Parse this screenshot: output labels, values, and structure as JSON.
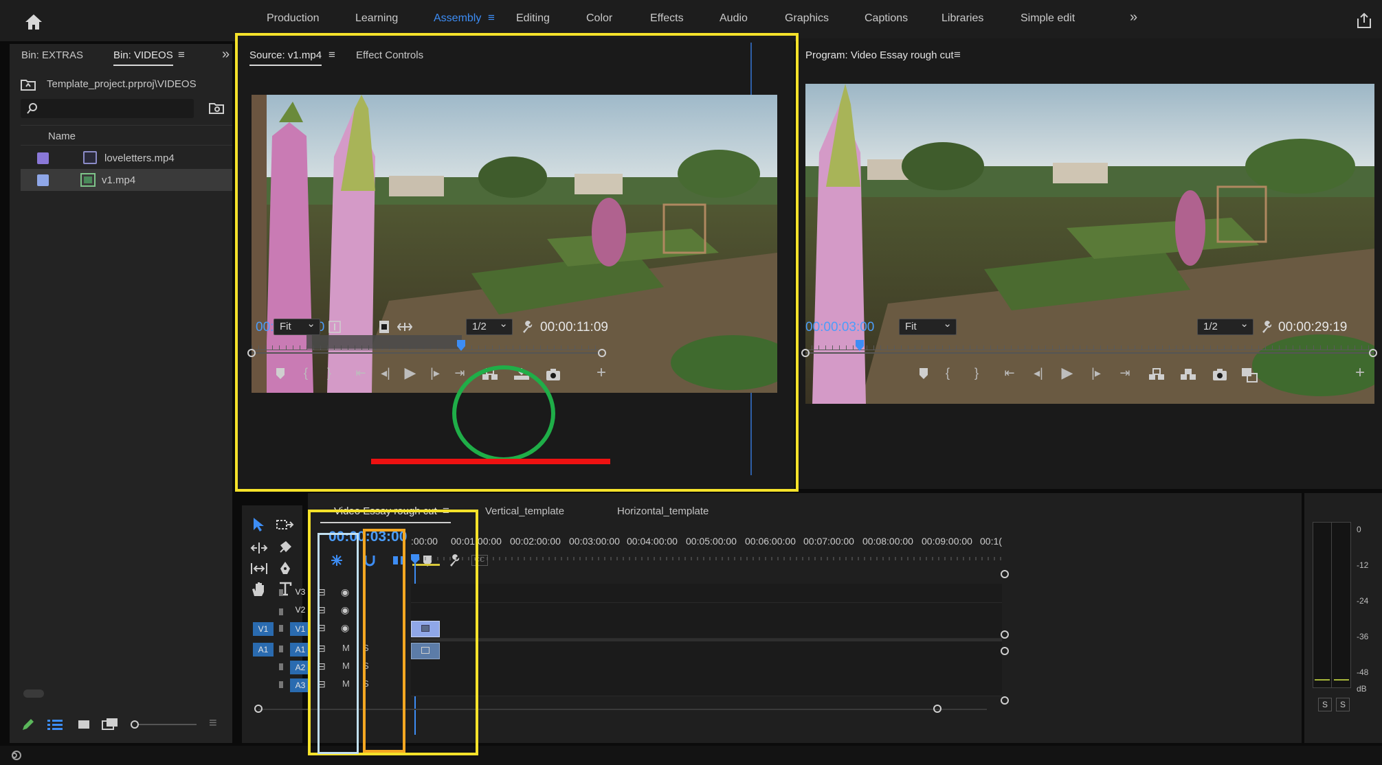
{
  "workspaces": [
    "Production",
    "Learning",
    "Assembly",
    "Editing",
    "Color",
    "Effects",
    "Audio",
    "Graphics",
    "Captions",
    "Libraries",
    "Simple edit"
  ],
  "active_workspace": "Assembly",
  "project_panel": {
    "tab_extras": "Bin: EXTRAS",
    "tab_videos": "Bin: VIDEOS",
    "path": "Template_project.prproj\\VIDEOS",
    "column_name": "Name",
    "items": [
      {
        "name": "loveletters.mp4",
        "color": "#8a78d8"
      },
      {
        "name": "v1.mp4",
        "color": "#8fa7e8"
      }
    ]
  },
  "source_monitor": {
    "tab_source": "Source: v1.mp4",
    "tab_effect_controls": "Effect Controls",
    "timecode_current": "00:00:19:10",
    "fit": "Fit",
    "resolution": "1/2",
    "duration": "00:00:11:09"
  },
  "program_monitor": {
    "title": "Program: Video Essay rough cut",
    "timecode_current": "00:00:03:00",
    "fit": "Fit",
    "resolution": "1/2",
    "duration": "00:00:29:19"
  },
  "timeline": {
    "tabs": [
      "Video Essay rough cut",
      "Vertical_template",
      "Horizontal_template"
    ],
    "timecode": "00:00:03:00",
    "ruler_ticks": [
      ":00:00",
      "00:01:00:00",
      "00:02:00:00",
      "00:03:00:00",
      "00:04:00:00",
      "00:05:00:00",
      "00:06:00:00",
      "00:07:00:00",
      "00:08:00:00",
      "00:09:00:00",
      "00:1("
    ],
    "source_patch": [
      "V1",
      "A1"
    ],
    "tracks": [
      "V3",
      "V2",
      "V1",
      "A1",
      "A2",
      "A3"
    ],
    "mute_label": "M",
    "solo_label": "S"
  },
  "meter": {
    "scale": [
      "0",
      "-12",
      "-24",
      "-36",
      "-48",
      "dB"
    ],
    "solo_buttons": [
      "S",
      "S"
    ]
  },
  "colors": {
    "accent": "#3d8df5",
    "highlight_yellow": "#f5e22a",
    "highlight_orange": "#f3a722",
    "highlight_green": "#1fae48",
    "highlight_red": "#ee1111"
  }
}
